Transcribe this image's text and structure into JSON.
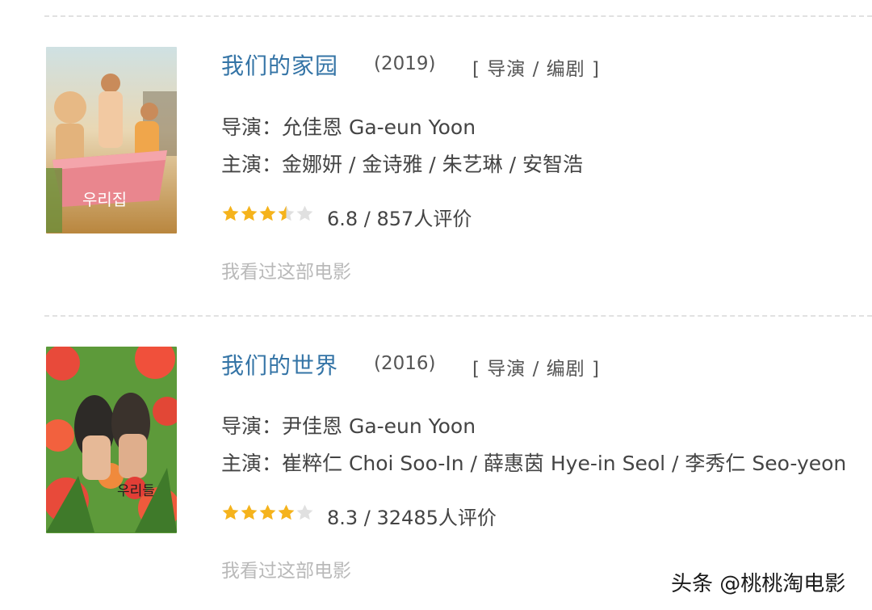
{
  "films": [
    {
      "title": "我们的家园",
      "year": "(2019)",
      "role": "[ 导演 / 编剧 ]",
      "director_line": "导演：允佳恩 Ga-eun Yoon",
      "cast_line": "主演：金娜妍 / 金诗雅 / 朱艺琳 / 安智浩",
      "rating_text": "6.8 / 857人评价",
      "stars": 3.5,
      "seen_label": "我看过这部电影",
      "poster_text": "우리집"
    },
    {
      "title": "我们的世界",
      "year": "(2016)",
      "role": "[ 导演 / 编剧 ]",
      "director_line": "导演：尹佳恩 Ga-eun Yoon",
      "cast_line": "主演：崔粹仁 Choi Soo-In / 薛惠茵 Hye-in Seol / 李秀仁 Seo-yeon",
      "rating_text": "8.3 / 32485人评价",
      "stars": 4,
      "seen_label": "我看过这部电影",
      "poster_text": "우리들"
    }
  ],
  "watermark": "头条 @桃桃淘电影",
  "colors": {
    "title": "#3474a6",
    "star_on": "#f5b31c",
    "star_off": "#e0e0e0"
  }
}
